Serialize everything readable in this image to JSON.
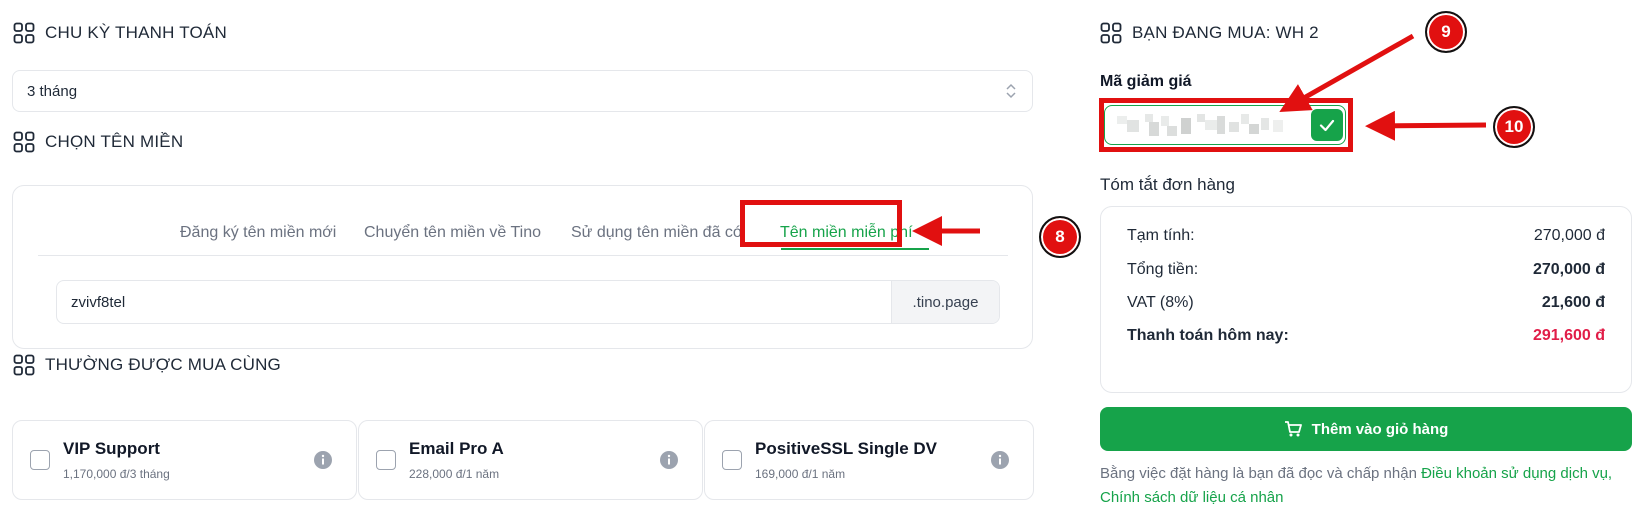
{
  "billing": {
    "title": "CHU KỲ THANH TOÁN",
    "selected": "3 tháng"
  },
  "domain": {
    "title": "CHỌN TÊN MIỀN",
    "tabs": [
      {
        "label": "Đăng ký tên miền mới",
        "active": false
      },
      {
        "label": "Chuyển tên miền về Tino",
        "active": false
      },
      {
        "label": "Sử dụng tên miền đã có",
        "active": false
      },
      {
        "label": "Tên miền miễn phí",
        "active": true
      }
    ],
    "input_value": "zvivf8tel",
    "suffix": ".tino.page"
  },
  "addons": {
    "title": "THƯỜNG ĐƯỢC MUA CÙNG",
    "items": [
      {
        "name": "VIP Support",
        "price": "1,170,000 đ/3 tháng"
      },
      {
        "name": "Email Pro A",
        "price": "228,000 đ/1 năm"
      },
      {
        "name": "PositiveSSL Single DV",
        "price": "169,000 đ/1 năm"
      }
    ]
  },
  "order": {
    "title": "BẠN ĐANG MUA: WH 2",
    "coupon_label": "Mã giảm giá",
    "summary_title": "Tóm tắt đơn hàng",
    "rows": [
      {
        "label": "Tạm tính:",
        "value": "270,000 đ"
      },
      {
        "label": "Tổng tiền:",
        "value": "270,000 đ"
      },
      {
        "label": "VAT (8%)",
        "value": "21,600 đ"
      },
      {
        "label": "Thanh toán hôm nay:",
        "value": "291,600 đ"
      }
    ],
    "cart_button": "Thêm vào giỏ hàng",
    "terms_prefix": "Bằng việc đặt hàng là bạn đã đọc và chấp nhận ",
    "terms_link1": "Điều khoản sử dụng dịch vụ",
    "terms_sep": ", ",
    "terms_link2": "Chính sách dữ liệu cá nhân"
  },
  "annotations": {
    "badge_8": "8",
    "badge_9": "9",
    "badge_10": "10",
    "color": "#e11010"
  },
  "colors": {
    "accent": "#16a34a",
    "total": "#e11d48"
  }
}
